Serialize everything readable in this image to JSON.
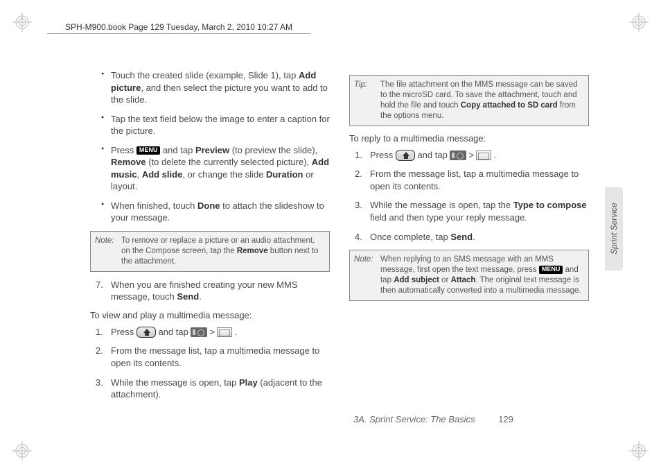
{
  "header": "SPH-M900.book  Page 129  Tuesday, March 2, 2010  10:27 AM",
  "col1": {
    "bullets": [
      {
        "pre": "Touch the created slide (example, Slide 1), tap ",
        "b1": "Add picture",
        "post": ", and then select the picture you want to add to the slide."
      },
      {
        "text": "Tap the text field below the image to enter a caption for the picture."
      },
      {
        "press": "Press ",
        "menu": "MENU",
        "mid1": " and tap ",
        "b1": "Preview",
        "mid2": " (to preview the slide), ",
        "b2": "Remove",
        "mid3": " (to delete the currently selected picture), ",
        "b3": "Add music",
        "comma": ", ",
        "b4": "Add slide",
        "mid4": ", or change the slide ",
        "b5": "Duration",
        "post": " or layout."
      },
      {
        "pre": "When finished, touch ",
        "b1": "Done",
        "post": " to attach the slideshow to your message."
      }
    ],
    "note1": {
      "label": "Note:",
      "pre": "To remove or replace a picture or an audio attachment, on the Compose screen, tap the ",
      "b": "Remove",
      "post": " button next to the attachment."
    },
    "step7": {
      "num": "7.",
      "pre": "When you are finished creating your new MMS message, touch ",
      "b": "Send",
      "post": "."
    },
    "subhead": "To view and play a multimedia message:",
    "steps": [
      {
        "num": "1.",
        "press": "Press ",
        "mid": " and tap ",
        "gt": ">",
        "post": " ."
      },
      {
        "num": "2.",
        "text": "From the message list, tap a multimedia message to open its contents."
      },
      {
        "num": "3.",
        "pre": "While the message is open, tap ",
        "b": "Play",
        "post": " (adjacent to the attachment)."
      }
    ]
  },
  "col2": {
    "tip": {
      "label": "Tip:",
      "pre": "The file attachment on the MMS message can be saved to the microSD card. To save the attachment, touch and hold the file and touch ",
      "b": "Copy attached to SD card",
      "post": " from the options menu."
    },
    "subhead": "To reply to a multimedia message:",
    "steps": [
      {
        "num": "1.",
        "press": "Press ",
        "mid": " and tap ",
        "gt": ">",
        "post": " ."
      },
      {
        "num": "2.",
        "text": "From the message list, tap a multimedia message to open its contents."
      },
      {
        "num": "3.",
        "pre": "While the message is open, tap the ",
        "b": "Type to compose",
        "post": " field and then type your reply message."
      },
      {
        "num": "4.",
        "pre": "Once complete, tap ",
        "b": "Send",
        "post": "."
      }
    ],
    "note2": {
      "label": "Note:",
      "pre": "When replying to an SMS message with an MMS message, first open the text message, press ",
      "menu": "MENU",
      "mid": " and tap ",
      "b1": "Add subject",
      "or": " or ",
      "b2": "Attach",
      "post": ". The original text message is then automatically converted into a multimedia message."
    }
  },
  "footer": {
    "section": "3A. Sprint Service: The Basics",
    "page": "129"
  },
  "sidetab": "Sprint Service"
}
